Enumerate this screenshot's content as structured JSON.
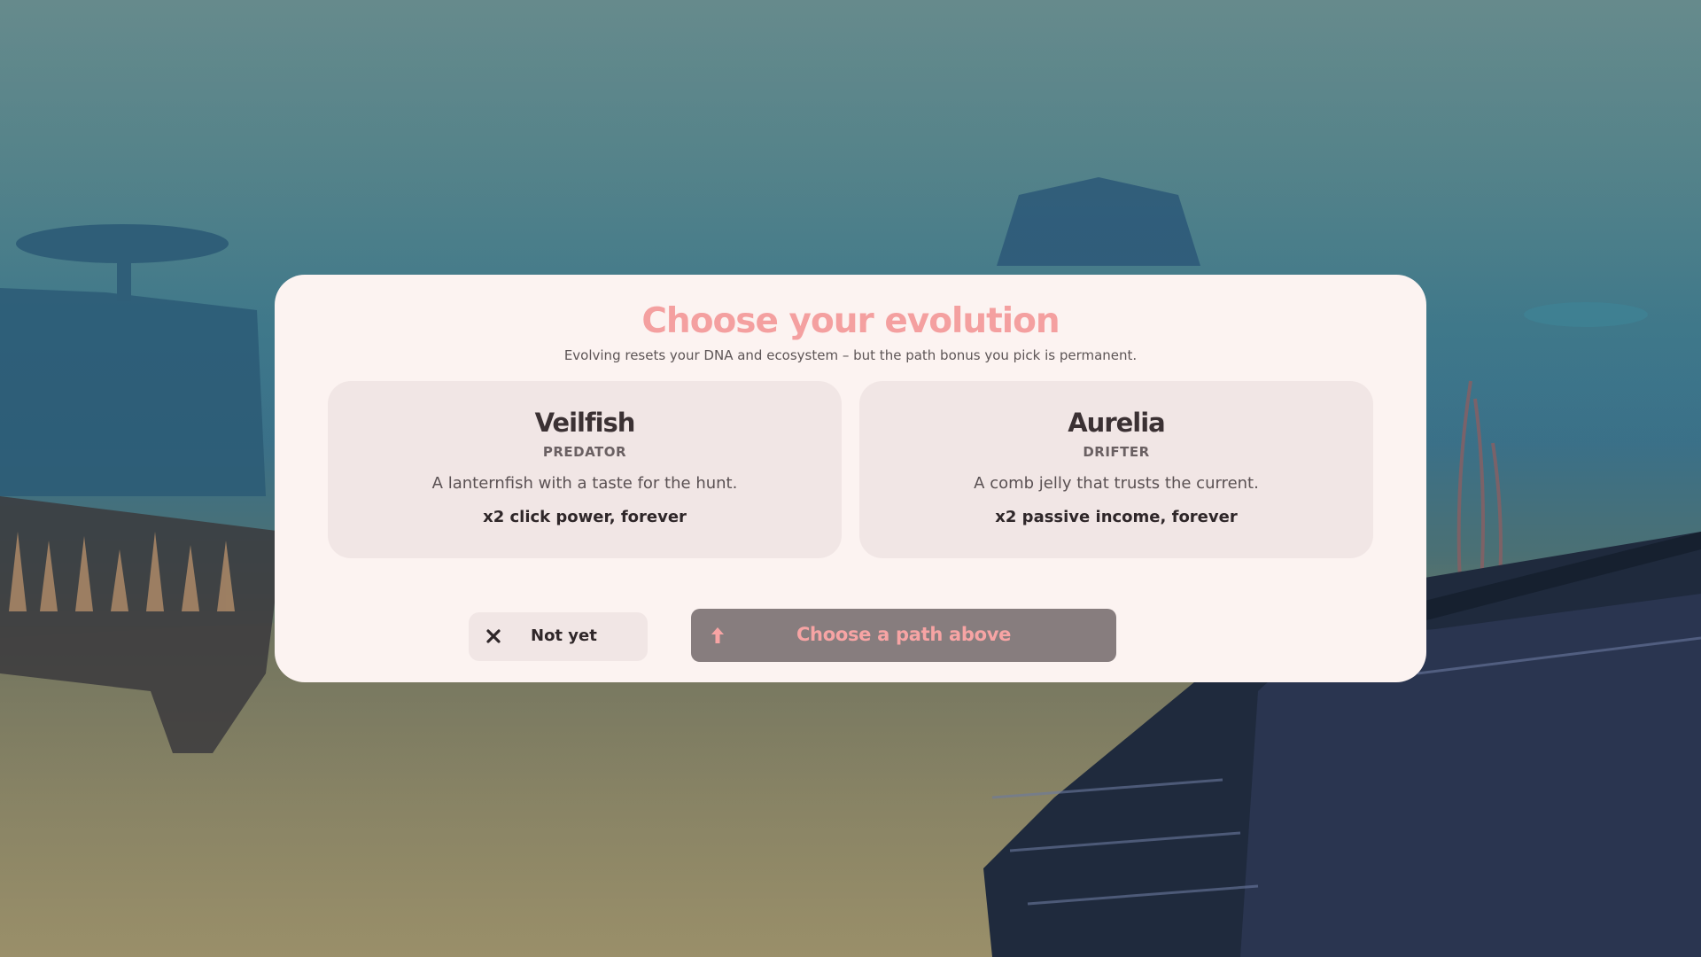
{
  "dialog": {
    "title": "Choose your evolution",
    "subtitle": "Evolving resets your DNA and ecosystem – but the path bonus you pick is permanent."
  },
  "paths": [
    {
      "name": "Veilfish",
      "role": "PREDATOR",
      "description": "A lanternfish with a taste for the hunt.",
      "bonus": "x2 click power, forever"
    },
    {
      "name": "Aurelia",
      "role": "DRIFTER",
      "description": "A comb jelly that trusts the current.",
      "bonus": "x2 passive income, forever"
    }
  ],
  "actions": {
    "cancel_label": "Not yet",
    "cancel_icon": "close-icon",
    "confirm_label": "Choose a path above",
    "confirm_icon": "arrow-up-icon",
    "confirm_disabled": true
  },
  "colors": {
    "title": "#f4a0a0",
    "panel": "#fcf3f1",
    "card": "#f1e6e5",
    "confirm_bg": "#877d7e",
    "confirm_text": "#f7a4a4"
  }
}
